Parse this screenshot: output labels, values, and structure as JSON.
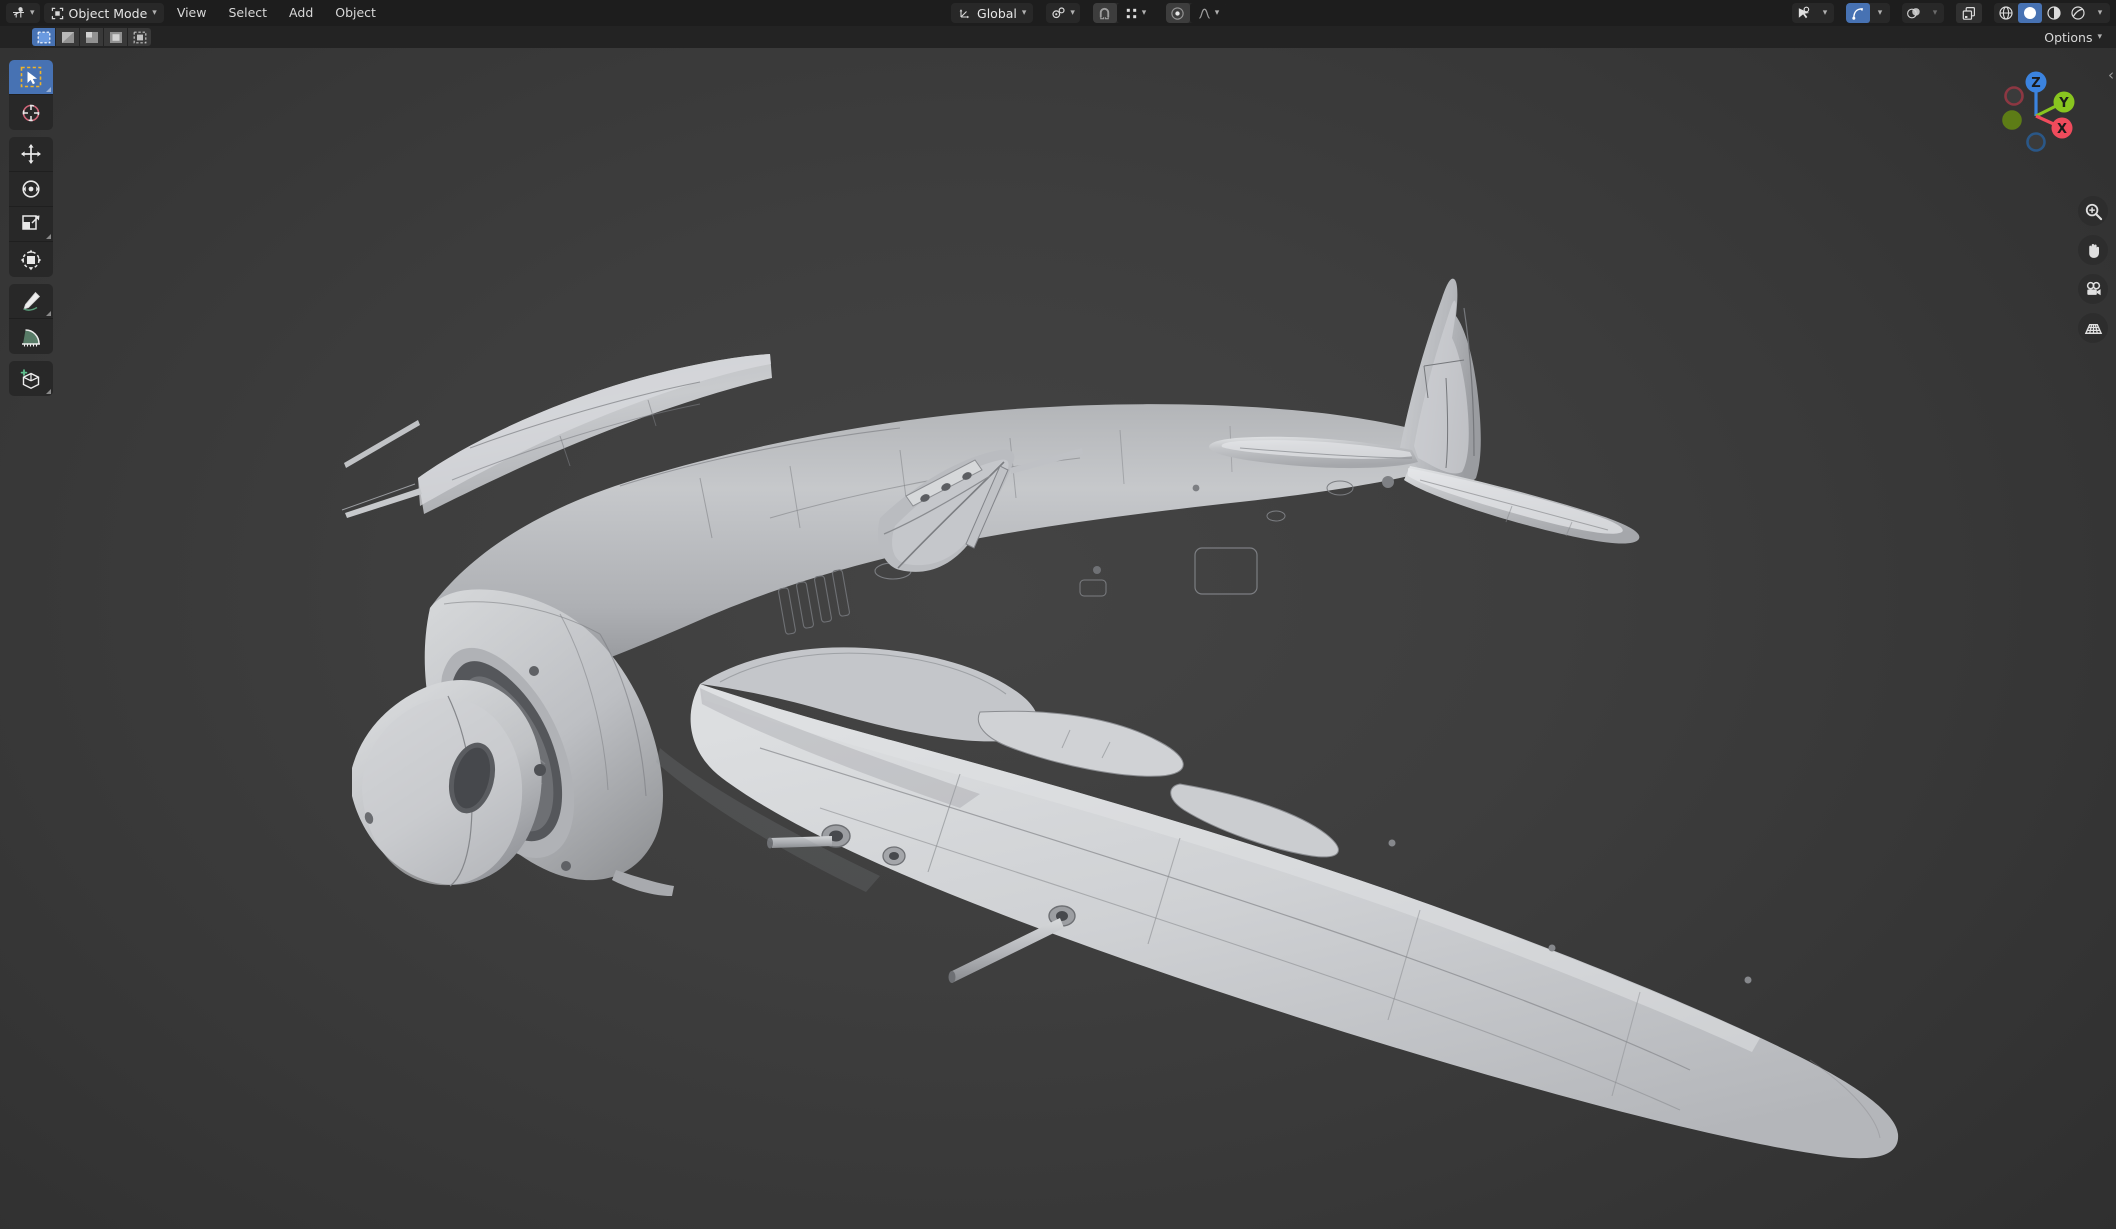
{
  "app": {
    "name": "Blender",
    "editor": "3D Viewport"
  },
  "header": {
    "editor_type_icon": "editor-type-3d-viewport-icon",
    "mode": {
      "label": "Object Mode",
      "icon": "object-mode-icon"
    },
    "menus": [
      "View",
      "Select",
      "Add",
      "Object"
    ],
    "transform_orientation": {
      "label": "Global",
      "icon": "orientation-axis-icon"
    },
    "pivot": {
      "icon": "pivot-point-icon"
    },
    "snap_magnet": {
      "icon": "snap-magnet-icon",
      "active": false
    },
    "snap_to": {
      "icon": "snap-element-icon"
    },
    "proportional_editing": {
      "icon": "proportional-editing-icon",
      "active": true
    },
    "proportional_falloff": {
      "icon": "falloff-smooth-icon"
    },
    "visibility": {
      "icon": "object-visibility-icon"
    },
    "gizmo": {
      "icon": "show-gizmo-icon",
      "active": true
    },
    "overlays": {
      "icon": "show-overlays-icon",
      "active": false
    },
    "xray": {
      "icon": "toggle-xray-icon",
      "active": false
    },
    "shading_modes": [
      {
        "name": "wireframe",
        "icon": "shading-wireframe-icon",
        "active": false
      },
      {
        "name": "solid",
        "icon": "shading-solid-icon",
        "active": true
      },
      {
        "name": "material",
        "icon": "shading-material-icon",
        "active": false
      },
      {
        "name": "rendered",
        "icon": "shading-rendered-icon",
        "active": false
      }
    ]
  },
  "tool_settings": {
    "select_modes": [
      {
        "name": "set-new-selection",
        "icon": "select-set-icon",
        "active": true
      },
      {
        "name": "extend-selection",
        "icon": "select-extend-icon",
        "active": false
      },
      {
        "name": "subtract-selection",
        "icon": "select-subtract-icon",
        "active": false
      },
      {
        "name": "invert-selection",
        "icon": "select-invert-icon",
        "active": false
      },
      {
        "name": "intersect-selection",
        "icon": "select-intersect-icon",
        "active": false
      }
    ],
    "options_label": "Options"
  },
  "toolbar": {
    "tools": [
      {
        "name": "tweak",
        "icon": "select-box-cursor-icon",
        "active": true,
        "has_submenu": true
      },
      {
        "name": "cursor",
        "icon": "3d-cursor-icon",
        "active": false,
        "has_submenu": false
      },
      {
        "name": "move",
        "icon": "move-arrows-icon",
        "active": false,
        "has_submenu": false
      },
      {
        "name": "rotate",
        "icon": "rotate-icon",
        "active": false,
        "has_submenu": false
      },
      {
        "name": "scale",
        "icon": "scale-icon",
        "active": false,
        "has_submenu": true
      },
      {
        "name": "transform",
        "icon": "transform-icon",
        "active": false,
        "has_submenu": false
      },
      {
        "name": "annotate",
        "icon": "annotate-pencil-icon",
        "active": false,
        "has_submenu": true
      },
      {
        "name": "measure",
        "icon": "measure-ruler-icon",
        "active": false,
        "has_submenu": false
      },
      {
        "name": "add-cube",
        "icon": "add-cube-icon",
        "active": false,
        "has_submenu": true
      }
    ]
  },
  "nav_gizmo": {
    "axes": [
      {
        "label": "Z",
        "color": "#3b83df",
        "positive": true
      },
      {
        "label": "Y",
        "color": "#88c51f",
        "positive": true
      },
      {
        "label": "X",
        "color": "#ef4b5c",
        "positive": true
      },
      {
        "label": "",
        "color": "#8d3742",
        "positive": false
      },
      {
        "label": "",
        "color": "#5d7c16",
        "positive": false
      },
      {
        "label": "",
        "color": "#2a5787",
        "positive": false
      }
    ]
  },
  "nav_buttons": [
    {
      "name": "zoom-view",
      "icon": "zoom-magnifier-icon"
    },
    {
      "name": "pan-view",
      "icon": "hand-pan-icon"
    },
    {
      "name": "camera-view",
      "icon": "camera-icon"
    },
    {
      "name": "toggle-projection",
      "icon": "perspective-grid-icon"
    }
  ],
  "viewport": {
    "scene_object": "fighter-aircraft-model",
    "background_color": "#3c3c3c",
    "model_color": "#c9cacc",
    "shading": "solid-clay"
  }
}
